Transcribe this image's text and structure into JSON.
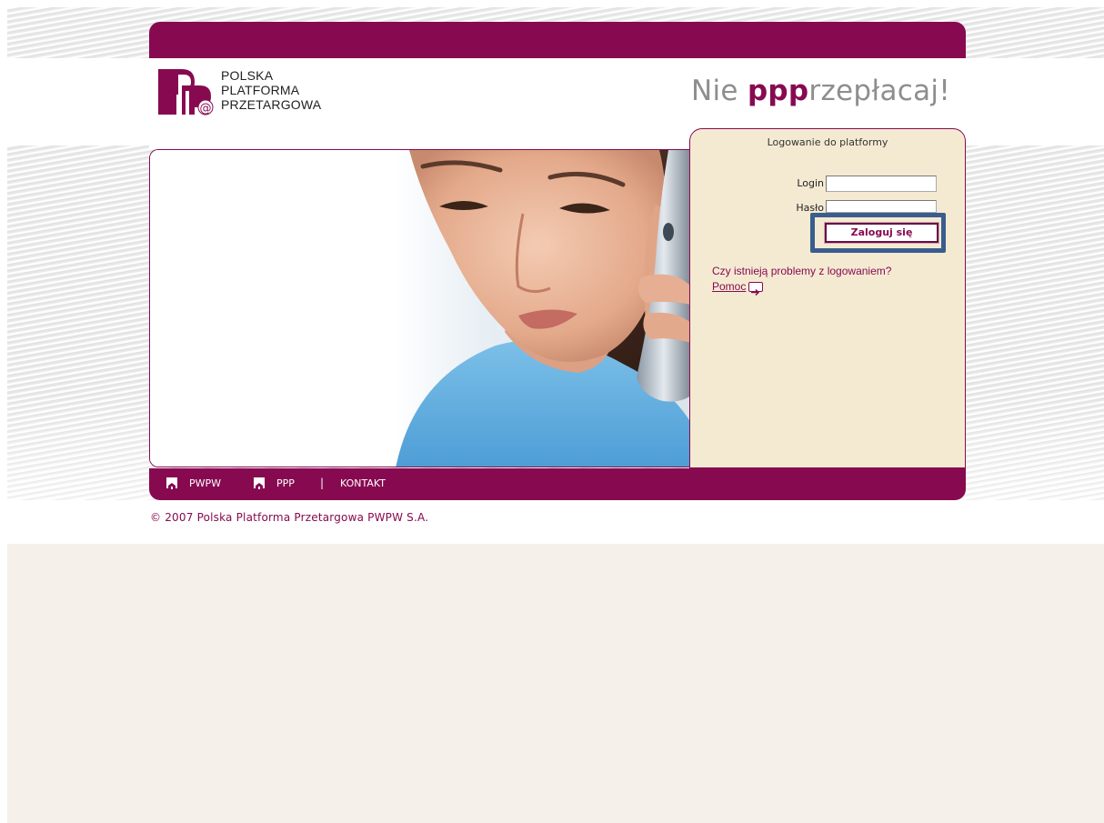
{
  "logo": {
    "line1": "POLSKA",
    "line2": "PLATFORMA",
    "line3": "PRZETARGOWA"
  },
  "slogan": {
    "prefix": "Nie ",
    "accent": "ppp",
    "suffix": "rzepłacaj!"
  },
  "login_panel": {
    "title": "Logowanie do platformy",
    "login_label": "Login",
    "login_value": "",
    "password_label": "Hasło",
    "password_value": "",
    "submit_label": "Zaloguj się",
    "help_question": "Czy istnieją problemy z logowaniem?",
    "help_link": "Pomoc"
  },
  "footer_nav": {
    "items": [
      {
        "label": "PWPW",
        "icon": "home-icon"
      },
      {
        "label": "PPP",
        "icon": "home-icon"
      },
      {
        "label": "KONTAKT"
      }
    ],
    "separator": "|"
  },
  "copyright": "© 2007 Polska Platforma Przetargowa PWPW S.A.",
  "colors": {
    "brand": "#870a51",
    "panel_bg": "#f4ead2",
    "highlight_frame": "#3a5d8e",
    "bottom_bg": "#f5f0ea"
  }
}
